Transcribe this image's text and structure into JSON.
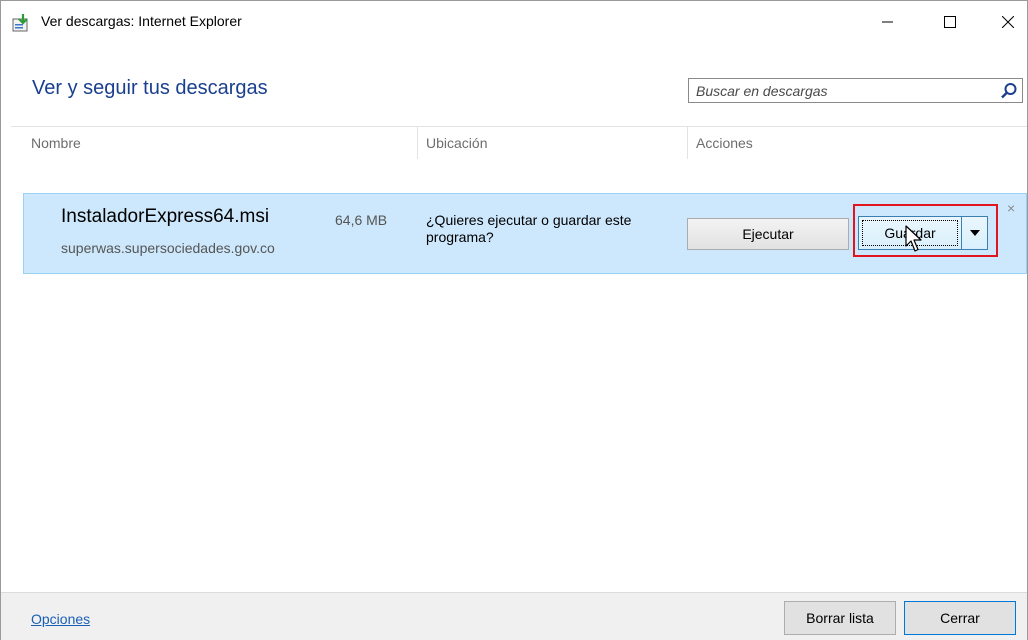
{
  "window": {
    "title": "Ver descargas: Internet Explorer",
    "controls": {
      "minimize": "—",
      "maximize": "☐",
      "close": "✕"
    }
  },
  "header": {
    "title": "Ver y seguir tus descargas",
    "search": {
      "placeholder": "Buscar en descargas",
      "value": ""
    }
  },
  "columns": [
    "Nombre",
    "Ubicación",
    "Acciones"
  ],
  "download": {
    "filename": "InstaladorExpress64.msi",
    "size": "64,6 MB",
    "source": "superwas.supersociedades.gov.co",
    "prompt": "¿Quieres ejecutar o guardar este programa?",
    "run_label": "Ejecutar",
    "save_label": "Guardar",
    "dismiss": "×"
  },
  "footer": {
    "options_label": "Opciones",
    "clear_list_label": "Borrar lista",
    "close_label": "Cerrar"
  },
  "colors": {
    "accent": "#1a3f8f",
    "row_bg": "#cde8fc",
    "highlight": "#e2151e",
    "link": "#1a5fb4"
  },
  "icons": {
    "app": "download-manager-icon",
    "search": "search-icon",
    "dropdown": "triangle-down-icon",
    "cursor": "arrow-cursor-icon"
  }
}
